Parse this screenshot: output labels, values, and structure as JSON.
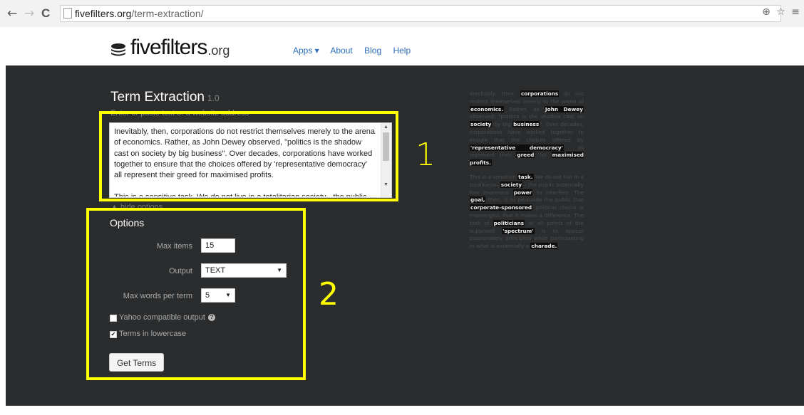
{
  "browser": {
    "url_host": "fivefilters.org",
    "url_path": "/term-extraction/",
    "back_icon": "←",
    "forward_icon": "→",
    "reload_icon": "C",
    "right_icons": "⊕ ☆ ≡"
  },
  "header": {
    "logo_text": "fivefilters",
    "logo_ext": ".org",
    "nav": [
      "Apps ▾",
      "About",
      "Blog",
      "Help"
    ]
  },
  "page": {
    "title": "Term Extraction",
    "version": "1.0",
    "input_prompt": "Enter or paste text or a website address",
    "textarea_value": "Inevitably, then, corporations do not restrict themselves merely to the arena of economics. Rather, as John Dewey observed, \"politics is the shadow cast on society by big business\". Over decades, corporations have worked together to ensure that the choices offered by 'representative democracy' all represent their greed for maximised profits.\n\nThis is a sensitive task. We do not live in a totalitarian society - the public",
    "hide_options": "▲ hide options",
    "annotation_1": "1",
    "annotation_2": "2"
  },
  "options": {
    "title": "Options",
    "max_items_label": "Max items",
    "max_items_value": "15",
    "output_label": "Output",
    "output_value": "TEXT",
    "max_words_label": "Max words per term",
    "max_words_value": "5",
    "yahoo_label": "Yahoo compatible output",
    "yahoo_checked": false,
    "lowercase_label": "Terms in lowercase",
    "lowercase_checked": true,
    "submit_label": "Get Terms"
  },
  "preview": {
    "paragraphs": [
      [
        {
          "t": "Inevitably, then, "
        },
        {
          "t": "corporations",
          "hl": true
        },
        {
          "t": " do not restrict themselves merely to the arena of "
        },
        {
          "t": "economics.",
          "hl": true
        },
        {
          "t": " Rather, as "
        },
        {
          "t": "John Dewey",
          "hl": true
        },
        {
          "t": " observed, \"politics is the shadow cast on "
        },
        {
          "t": "society",
          "hl": true
        },
        {
          "t": " by big "
        },
        {
          "t": "business",
          "hl": true
        },
        {
          "t": "\". Over decades, corporations have worked together to ensure that the choices offered by "
        },
        {
          "t": "'representative democracy'",
          "hl": true
        },
        {
          "t": " all represent their "
        },
        {
          "t": "greed",
          "hl": true
        },
        {
          "t": " for "
        },
        {
          "t": "maximised profits.",
          "hl": true
        }
      ],
      [
        {
          "t": "This is a sensitive "
        },
        {
          "t": "task.",
          "hl": true
        },
        {
          "t": " We do not live in a totalitarian "
        },
        {
          "t": "society",
          "hl": true
        },
        {
          "t": " - the public potentially has enormous "
        },
        {
          "t": "power",
          "hl": true
        },
        {
          "t": " to interfere. The "
        },
        {
          "t": "goal,",
          "hl": true
        },
        {
          "t": " then, is to persuade the public that "
        },
        {
          "t": "corporate-sponsored",
          "hl": true
        },
        {
          "t": " political choice is meaningful, that it makes a difference. The task of "
        },
        {
          "t": "politicians",
          "hl": true
        },
        {
          "t": " at all points of the supposed "
        },
        {
          "t": "'spectrum'",
          "hl": true
        },
        {
          "t": " is to appear passionately principled while participating in what is essentially a "
        },
        {
          "t": "charade.",
          "hl": true
        }
      ]
    ]
  }
}
